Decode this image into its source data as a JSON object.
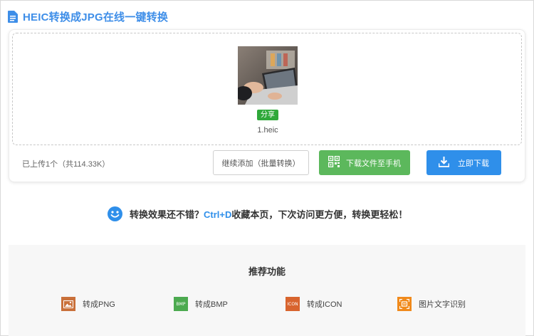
{
  "header": {
    "title": "HEIC转换成JPG在线一键转换"
  },
  "upload": {
    "share_label": "分享",
    "file_name": "1.heic",
    "status": "已上传1个（共114.33K）",
    "continue_label": "继续添加（批量转换）",
    "phone_label": "下载文件至手机",
    "download_label": "立即下载"
  },
  "promo": {
    "before": "转换效果还不错？",
    "highlight": "Ctrl+D",
    "after": "收藏本页，下次访问更方便，转换更轻松！"
  },
  "recommend": {
    "title": "推荐功能",
    "items": [
      {
        "label": "转成PNG",
        "icon": "image-icon",
        "icon_text": "",
        "color": "#c9703a"
      },
      {
        "label": "转成BMP",
        "icon": "bmp-icon",
        "icon_text": "BMP",
        "color": "#4caa50"
      },
      {
        "label": "转成ICON",
        "icon": "icon-file-icon",
        "icon_text": "ICON",
        "color": "#d8642e"
      },
      {
        "label": "图片文字识别",
        "icon": "ocr-icon",
        "icon_text": "",
        "color": "#f08a1c"
      }
    ]
  },
  "colors": {
    "accent": "#2f8fea",
    "green": "#5cb85c",
    "title": "#3e8ee8"
  }
}
